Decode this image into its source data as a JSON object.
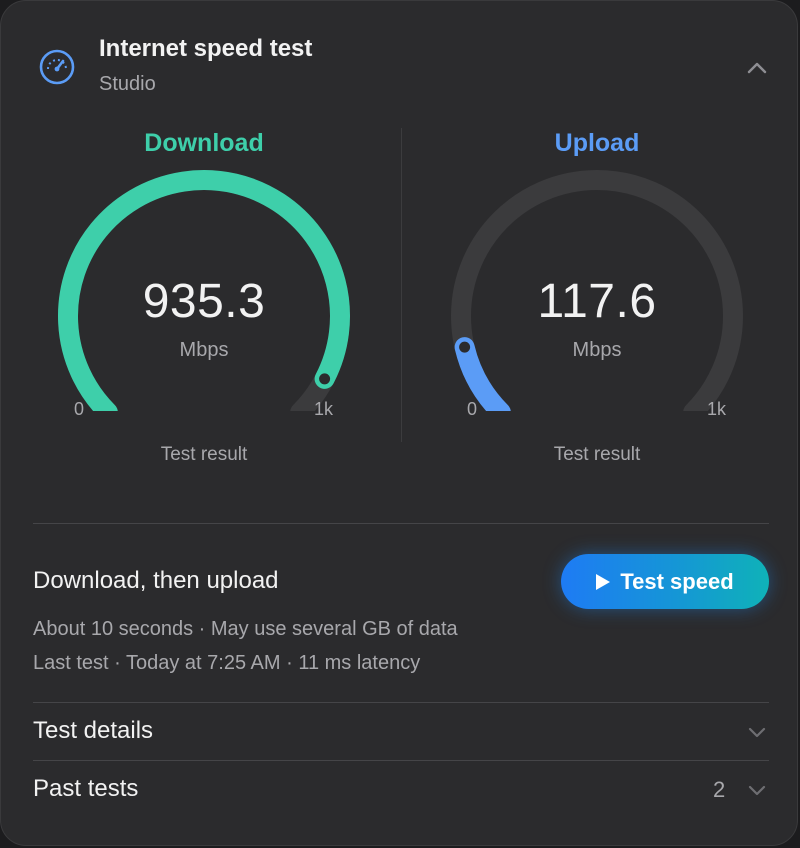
{
  "header": {
    "title": "Internet speed test",
    "subtitle": "Studio",
    "icon": "speedometer-icon"
  },
  "download": {
    "label": "Download",
    "value": "935.3",
    "unit": "Mbps",
    "min_label": "0",
    "max_label": "1k",
    "caption": "Test result",
    "fraction": 0.9353,
    "color": "#3ecfaa"
  },
  "upload": {
    "label": "Upload",
    "value": "117.6",
    "unit": "Mbps",
    "min_label": "0",
    "max_label": "1k",
    "caption": "Test result",
    "fraction": 0.1176,
    "color": "#5b9cf6"
  },
  "test": {
    "mode": "Download, then upload",
    "duration_note": "About 10 seconds · May use several GB of data",
    "last_test": "Last test · Today at 7:25 AM · 11 ms latency",
    "button_label": "Test speed"
  },
  "sections": {
    "details_label": "Test details",
    "past_label": "Past tests",
    "past_count": "2"
  },
  "colors": {
    "track": "#3b3b3d",
    "download": "#3ecfaa",
    "upload": "#5b9cf6",
    "button_start": "#1e7bf4",
    "button_end": "#0fb2b8"
  }
}
